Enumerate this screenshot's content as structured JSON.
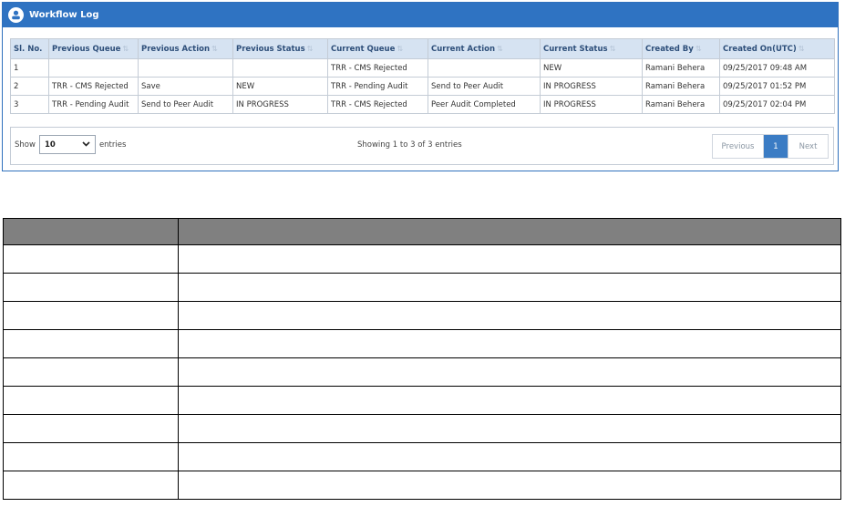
{
  "panel": {
    "title": "Workflow Log",
    "icon": "workflow-log-icon",
    "header_color": "#2f73c2"
  },
  "table": {
    "columns": [
      "Sl. No.",
      "Previous Queue",
      "Previous Action",
      "Previous Status",
      "Current Queue",
      "Current Action",
      "Current Status",
      "Created By",
      "Created On(UTC)"
    ],
    "sort_glyph": "⇅",
    "rows": [
      [
        "1",
        "",
        "",
        "",
        "TRR - CMS Rejected",
        "",
        "NEW",
        "Ramani Behera",
        "09/25/2017 09:48 AM"
      ],
      [
        "2",
        "TRR - CMS Rejected",
        "Save",
        "NEW",
        "TRR - Pending Audit",
        "Send to Peer Audit",
        "IN PROGRESS",
        "Ramani Behera",
        "09/25/2017 01:52 PM"
      ],
      [
        "3",
        "TRR - Pending Audit",
        "Send to Peer Audit",
        "IN PROGRESS",
        "TRR - CMS Rejected",
        "Peer Audit Completed",
        "IN PROGRESS",
        "Ramani Behera",
        "09/25/2017 02:04 PM"
      ]
    ]
  },
  "footer": {
    "show_label": "Show",
    "entries_value": "10",
    "entries_label": "entries",
    "info": "Showing 1 to 3 of 3 entries",
    "prev_label": "Previous",
    "current_page": "1",
    "next_label": "Next",
    "accent": "#3b7cc4"
  },
  "grid": {
    "header_color": "#808080",
    "row_count": 9
  }
}
